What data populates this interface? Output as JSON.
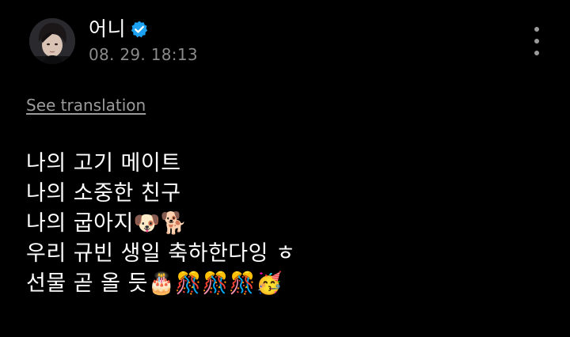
{
  "post": {
    "author_name": "어니",
    "verified": true,
    "timestamp": "08. 29. 18:13",
    "translate_label": "See translation",
    "lines": [
      "나의 고기 메이트",
      "나의 소중한 친구",
      "나의 굽아지🐶🐕",
      "우리 규빈 생일 축하한다잉 ㅎ",
      "선물 곧 올 듯🎂🎊🎊🎊🥳"
    ]
  },
  "icons": {
    "verified": "verified-badge-icon",
    "more": "more-vertical-icon",
    "avatar": "profile-avatar"
  },
  "colors": {
    "background": "#000000",
    "text": "#ffffff",
    "muted": "#8a8a8a",
    "verified": "#1da1f2"
  }
}
